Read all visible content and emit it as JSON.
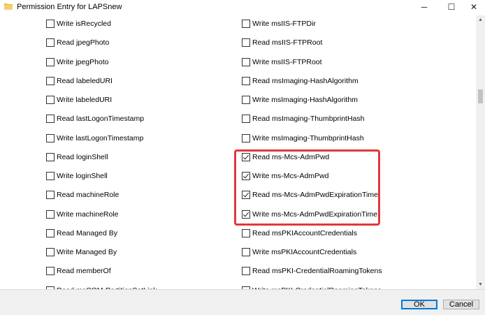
{
  "window": {
    "title": "Permission Entry for LAPSnew",
    "minimize": "─",
    "maximize": "☐",
    "close": "✕"
  },
  "permissions_left": [
    {
      "label": "Write isRecycled",
      "checked": false
    },
    {
      "label": "Read jpegPhoto",
      "checked": false
    },
    {
      "label": "Write jpegPhoto",
      "checked": false
    },
    {
      "label": "Read labeledURI",
      "checked": false
    },
    {
      "label": "Write labeledURI",
      "checked": false
    },
    {
      "label": "Read lastLogonTimestamp",
      "checked": false
    },
    {
      "label": "Write lastLogonTimestamp",
      "checked": false
    },
    {
      "label": "Read loginShell",
      "checked": false
    },
    {
      "label": "Write loginShell",
      "checked": false
    },
    {
      "label": "Read machineRole",
      "checked": false
    },
    {
      "label": "Write machineRole",
      "checked": false
    },
    {
      "label": "Read Managed By",
      "checked": false
    },
    {
      "label": "Write Managed By",
      "checked": false
    },
    {
      "label": "Read memberOf",
      "checked": false
    },
    {
      "label": "Read msCOM-PartitionSetLink",
      "checked": false
    }
  ],
  "permissions_right": [
    {
      "label": "Write msIIS-FTPDir",
      "checked": false
    },
    {
      "label": "Read msIIS-FTPRoot",
      "checked": false
    },
    {
      "label": "Write msIIS-FTPRoot",
      "checked": false
    },
    {
      "label": "Read msImaging-HashAlgorithm",
      "checked": false
    },
    {
      "label": "Write msImaging-HashAlgorithm",
      "checked": false
    },
    {
      "label": "Read msImaging-ThumbprintHash",
      "checked": false
    },
    {
      "label": "Write msImaging-ThumbprintHash",
      "checked": false
    },
    {
      "label": "Read ms-Mcs-AdmPwd",
      "checked": true
    },
    {
      "label": "Write ms-Mcs-AdmPwd",
      "checked": true
    },
    {
      "label": "Read ms-Mcs-AdmPwdExpirationTime",
      "checked": true
    },
    {
      "label": "Write ms-Mcs-AdmPwdExpirationTime",
      "checked": true
    },
    {
      "label": "Read msPKIAccountCredentials",
      "checked": false
    },
    {
      "label": "Write msPKIAccountCredentials",
      "checked": false
    },
    {
      "label": "Read msPKI-CredentialRoamingTokens",
      "checked": false
    },
    {
      "label": "Write msPKI-CredentialRoamingTokens",
      "checked": false
    }
  ],
  "scrollbar": {
    "up_arrow": "▲",
    "down_arrow": "▼"
  },
  "buttons": {
    "ok": "OK",
    "cancel": "Cancel"
  },
  "colors": {
    "highlight": "#e0393c",
    "ok_border": "#0078d7",
    "folder_icon": "#e8b84a"
  },
  "icons": {
    "title": "folder-icon"
  }
}
